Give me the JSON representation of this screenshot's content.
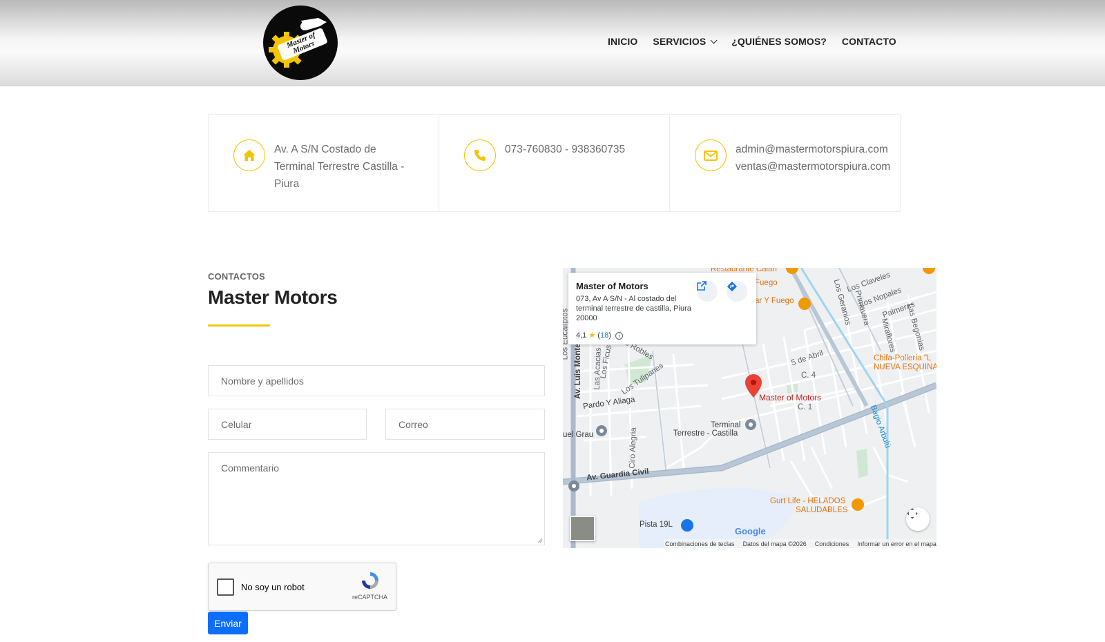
{
  "brand": {
    "logo_text": "Master of Motors"
  },
  "nav": {
    "items": [
      {
        "label": "INICIO"
      },
      {
        "label": "SERVICIOS",
        "has_dropdown": true
      },
      {
        "label": "¿QUIÉNES SOMOS?"
      },
      {
        "label": "CONTACTO"
      }
    ]
  },
  "info": {
    "address": {
      "icon": "home-icon",
      "lines": [
        "Av. A S/N Costado de",
        "Terminal Terrestre Castilla -",
        "Piura"
      ]
    },
    "phone": {
      "icon": "phone-icon",
      "lines": [
        "073-760830 - 938360735"
      ]
    },
    "email": {
      "icon": "envelope-icon",
      "lines": [
        "admin@mastermotorspiura.com",
        "ventas@mastermotorspiura.com"
      ]
    }
  },
  "contact": {
    "kicker": "CONTACTOS",
    "title": "Master Motors",
    "fields": {
      "name_placeholder": "Nombre y apellidos",
      "phone_placeholder": "Celular",
      "email_placeholder": "Correo",
      "comment_placeholder": "Commentario"
    },
    "recaptcha": {
      "label": "No soy un robot",
      "brand": "reCAPTCHA"
    },
    "submit_label": "Enviar"
  },
  "map": {
    "card": {
      "title": "Master of Motors",
      "address": "073, Av A S/N - Al costado del terminal terrestre de castilla, Piura 20000",
      "rating": "4,1",
      "reviews": "18"
    },
    "pin_label": "Master of Motors",
    "labels": [
      "Restaurante Calah",
      "Fuego",
      "ar Y Fuego",
      "Los Claveles",
      "Los Nopales",
      "Palmeras",
      "Los Geranios",
      "Primavera",
      "Miraflores",
      "Las Begonias",
      "Chifa-Pollería \"L",
      "NUEVA ESQUINA",
      "5 de Abril",
      "C. 4",
      "C. 1",
      "Los Robles",
      "Los Tulipanes",
      "Los Ficus",
      "Las Acacias",
      "Av. Luis Montero",
      "Pardo Y Aliaga",
      "uel Grau",
      "Terminal",
      "Terrestre - Castilla",
      "Ciro Alegria",
      "Av. Guardia Civil",
      "Gurt Life - HELADOS",
      "SALUDABLES",
      "Pista 19L",
      "Bagio Arbulú",
      "Los Eucaliptos"
    ],
    "google": "Google",
    "footer": [
      "Combinaciones de teclas",
      "Datos del mapa ©2026",
      "Condiciones",
      "Informar un error en el mapa"
    ]
  }
}
